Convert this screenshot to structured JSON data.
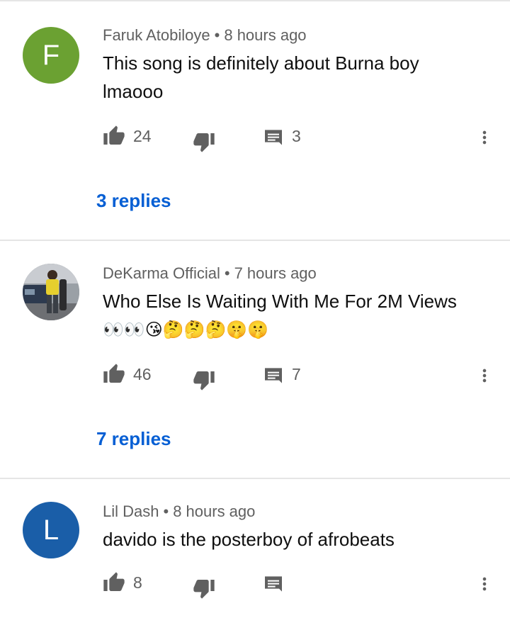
{
  "comments": [
    {
      "author": "Faruk Atobiloye",
      "time": "8 hours ago",
      "avatar_letter": "F",
      "avatar_color": "#6ba132",
      "text": "This song is definitely about Burna boy lmaooo",
      "likes": "24",
      "reply_count": "3",
      "replies_link": "3 replies"
    },
    {
      "author": "DeKarma Official",
      "time": "7 hours ago",
      "text": "Who Else Is Waiting With Me For 2M Views",
      "emojis": "👀👀😘🤔🤔🤔🤫🤫",
      "likes": "46",
      "reply_count": "7",
      "replies_link": "7 replies"
    },
    {
      "author": "Lil Dash",
      "time": "8 hours ago",
      "avatar_letter": "L",
      "avatar_color": "#1a5ea8",
      "text": "davido is the posterboy of afrobeats",
      "likes": "8"
    }
  ],
  "separator": "•",
  "icons": {
    "like": "thumbs-up-icon",
    "dislike": "thumbs-down-icon",
    "reply": "comment-icon",
    "more": "more-vert-icon"
  }
}
